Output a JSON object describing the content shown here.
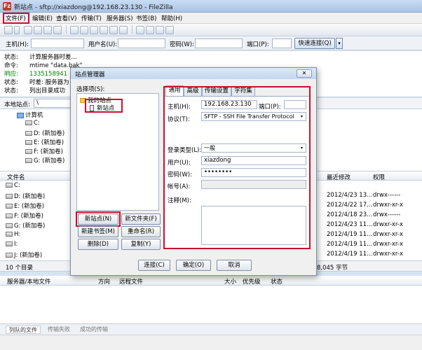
{
  "window": {
    "title": "新站点 - sftp://xiazdong@192.168.23.130 - FileZilla",
    "app_icon": "Fz"
  },
  "menu": [
    "文件(F)",
    "编辑(E)",
    "查看(V)",
    "传输(T)",
    "服务器(S)",
    "书签(B)",
    "帮助(H)"
  ],
  "quickconnect": {
    "host_label": "主机(H):",
    "user_label": "用户名(U):",
    "pass_label": "密码(W):",
    "port_label": "端口(P):",
    "button": "快速连接(Q)",
    "arrow": "▾"
  },
  "log": [
    {
      "label": "状态:",
      "text": "计算服务器时差...",
      "color": "#000000"
    },
    {
      "label": "命令:",
      "text": "mtime \"data.bak\"",
      "color": "#000000"
    },
    {
      "label": "响应:",
      "text": "1335158941",
      "color": "#008000"
    },
    {
      "label": "状态:",
      "text": "时差: 服务器为",
      "color": "#000000"
    },
    {
      "label": "状态:",
      "text": "列出目录成功",
      "color": "#000000"
    }
  ],
  "local": {
    "site_label": "本地站点:",
    "path": "\\",
    "tree": [
      "计算机",
      "C:",
      "D: (新加卷)",
      "E: (新加卷)",
      "F: (新加卷)",
      "G: (新加卷)"
    ]
  },
  "filelist": {
    "col_name": "文件名",
    "col_modified": "最近修改",
    "col_perm": "权限",
    "rows": [
      {
        "name": "C:",
        "modified": "",
        "perm": ""
      },
      {
        "name": "D: (新加卷)",
        "modified": "2012/4/23 13...",
        "perm": "drwx------"
      },
      {
        "name": "E: (新加卷)",
        "modified": "2012/4/22 17...",
        "perm": "drwxr-xr-x"
      },
      {
        "name": "F: (新加卷)",
        "modified": "2012/4/18 23...",
        "perm": "drwx------"
      },
      {
        "name": "G: (新加卷)",
        "modified": "2012/4/23 11...",
        "perm": "drwxr-xr-x"
      },
      {
        "name": "H:",
        "modified": "2012/4/19 11...",
        "perm": "drwxr-xr-x"
      },
      {
        "name": "I:",
        "modified": "2012/4/19 11...",
        "perm": "drwxr-xr-x"
      },
      {
        "name": "J: (新加卷)",
        "modified": "2012/4/19 11...",
        "perm": "drwxr-xr-x"
      }
    ],
    "left_status": "10 个目录",
    "right_status": "8,045 字节"
  },
  "queue": {
    "col_server": "服务器/本地文件",
    "col_direction": "方向",
    "col_remote": "远程文件",
    "col_size": "大小",
    "col_priority": "优先级",
    "col_status": "状态"
  },
  "bottom_tabs": [
    "列队的文件",
    "传输失败",
    "成功的传输"
  ],
  "dialog": {
    "title": "站点管理器",
    "close": "✕",
    "select_label": "选择项(S):",
    "tree": {
      "root": "我的站点",
      "site": "新站点"
    },
    "buttons": {
      "new_site": "新站点(N)",
      "new_folder": "新文件夹(F)",
      "new_bookmark": "新建书签(M)",
      "rename": "重命名(R)",
      "delete": "删除(D)",
      "copy": "复制(Y)",
      "connect": "连接(C)",
      "ok": "确定(O)",
      "cancel": "取消"
    },
    "tabs": [
      "通用",
      "高级",
      "传输设置",
      "字符集"
    ],
    "fields": {
      "host_label": "主机(H):",
      "host_value": "192.168.23.130",
      "port_label": "端口(P):",
      "port_value": "",
      "protocol_label": "协议(T):",
      "protocol_value": "SFTP - SSH File Transfer Protocol",
      "logon_label": "登录类型(L):",
      "logon_value": "一般",
      "user_label": "用户(U):",
      "user_value": "xiazdong",
      "password_label": "密码(W):",
      "password_value": "••••••••",
      "account_label": "帐号(A):",
      "account_value": "",
      "comment_label": "注释(M):"
    },
    "select_arrow": "▾"
  },
  "colors": {
    "highlight": "#c8102e",
    "log_response": "#008000"
  }
}
